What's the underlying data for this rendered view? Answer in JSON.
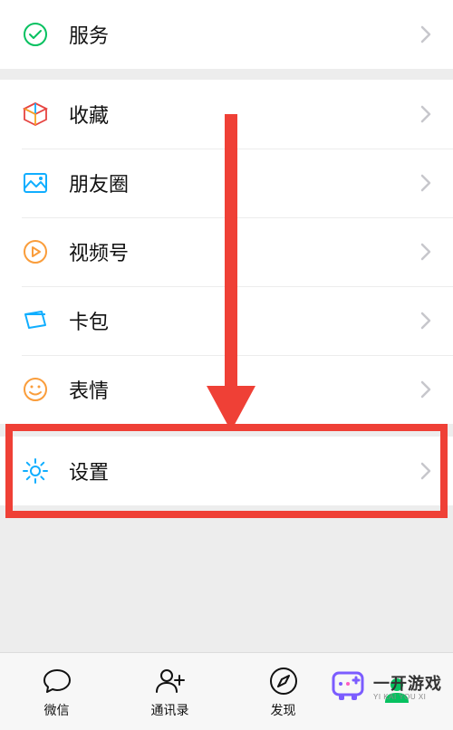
{
  "rows": {
    "services": {
      "label": "服务"
    },
    "favorites": {
      "label": "收藏"
    },
    "moments": {
      "label": "朋友圈"
    },
    "channels": {
      "label": "视频号"
    },
    "cards": {
      "label": "卡包"
    },
    "stickers": {
      "label": "表情"
    },
    "settings": {
      "label": "设置"
    }
  },
  "tabs": {
    "wechat": {
      "label": "微信"
    },
    "contacts": {
      "label": "通讯录"
    },
    "discover": {
      "label": "发现"
    },
    "me": {
      "label": ""
    }
  },
  "watermark": {
    "title": "一开游戏",
    "subtitle": "YI KAI YOU XI"
  },
  "annotation": {
    "highlight_target": "settings"
  }
}
